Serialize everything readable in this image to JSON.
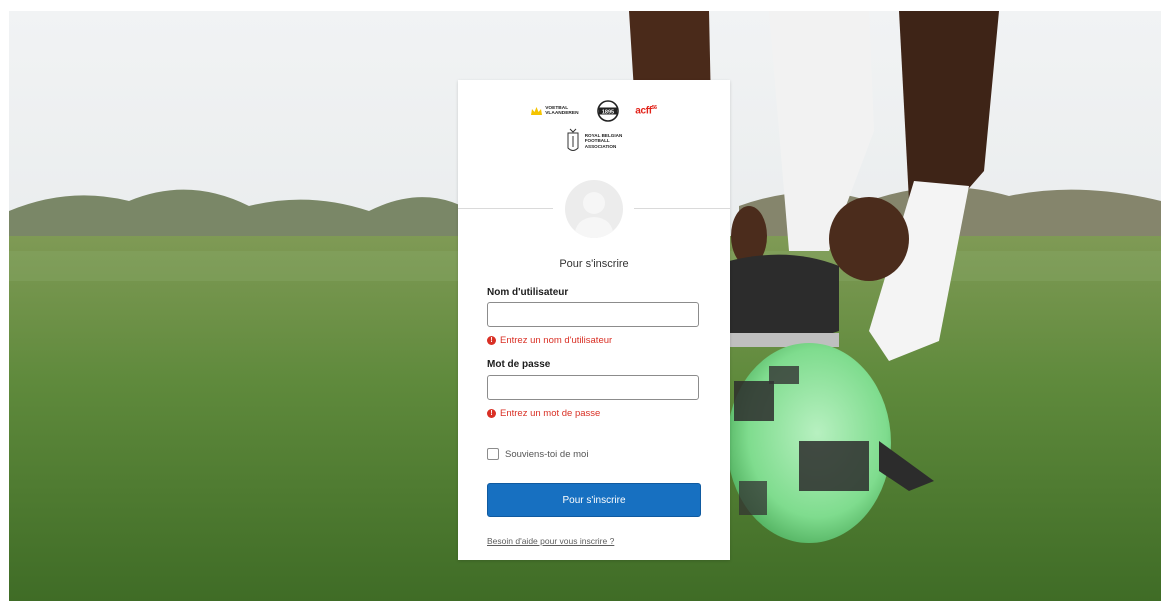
{
  "logos": {
    "voetbal_vlaanderen": "VOETBAL VLAANDEREN",
    "crest_year": "1895",
    "acff": "acff",
    "acff_sup": "56",
    "rbfa_line1": "ROYAL BELGIAN",
    "rbfa_line2": "FOOTBALL",
    "rbfa_line3": "ASSOCIATION"
  },
  "form": {
    "title": "Pour s'inscrire",
    "username_label": "Nom d'utilisateur",
    "username_value": "",
    "username_error": "Entrez un nom d'utilisateur",
    "password_label": "Mot de passe",
    "password_value": "",
    "password_error": "Entrez un mot de passe",
    "remember_label": "Souviens-toi de moi",
    "remember_checked": false,
    "submit_label": "Pour s'inscrire",
    "help_link": "Besoin d'aide pour vous inscrire ?"
  },
  "icons": {
    "error": "exclamation-circle-icon",
    "avatar": "user-silhouette-icon",
    "checkbox": "checkbox-icon"
  },
  "colors": {
    "primary_button": "#1770c1",
    "error": "#d93025",
    "acff_red": "#e2231a",
    "vv_yellow": "#f5c400"
  }
}
